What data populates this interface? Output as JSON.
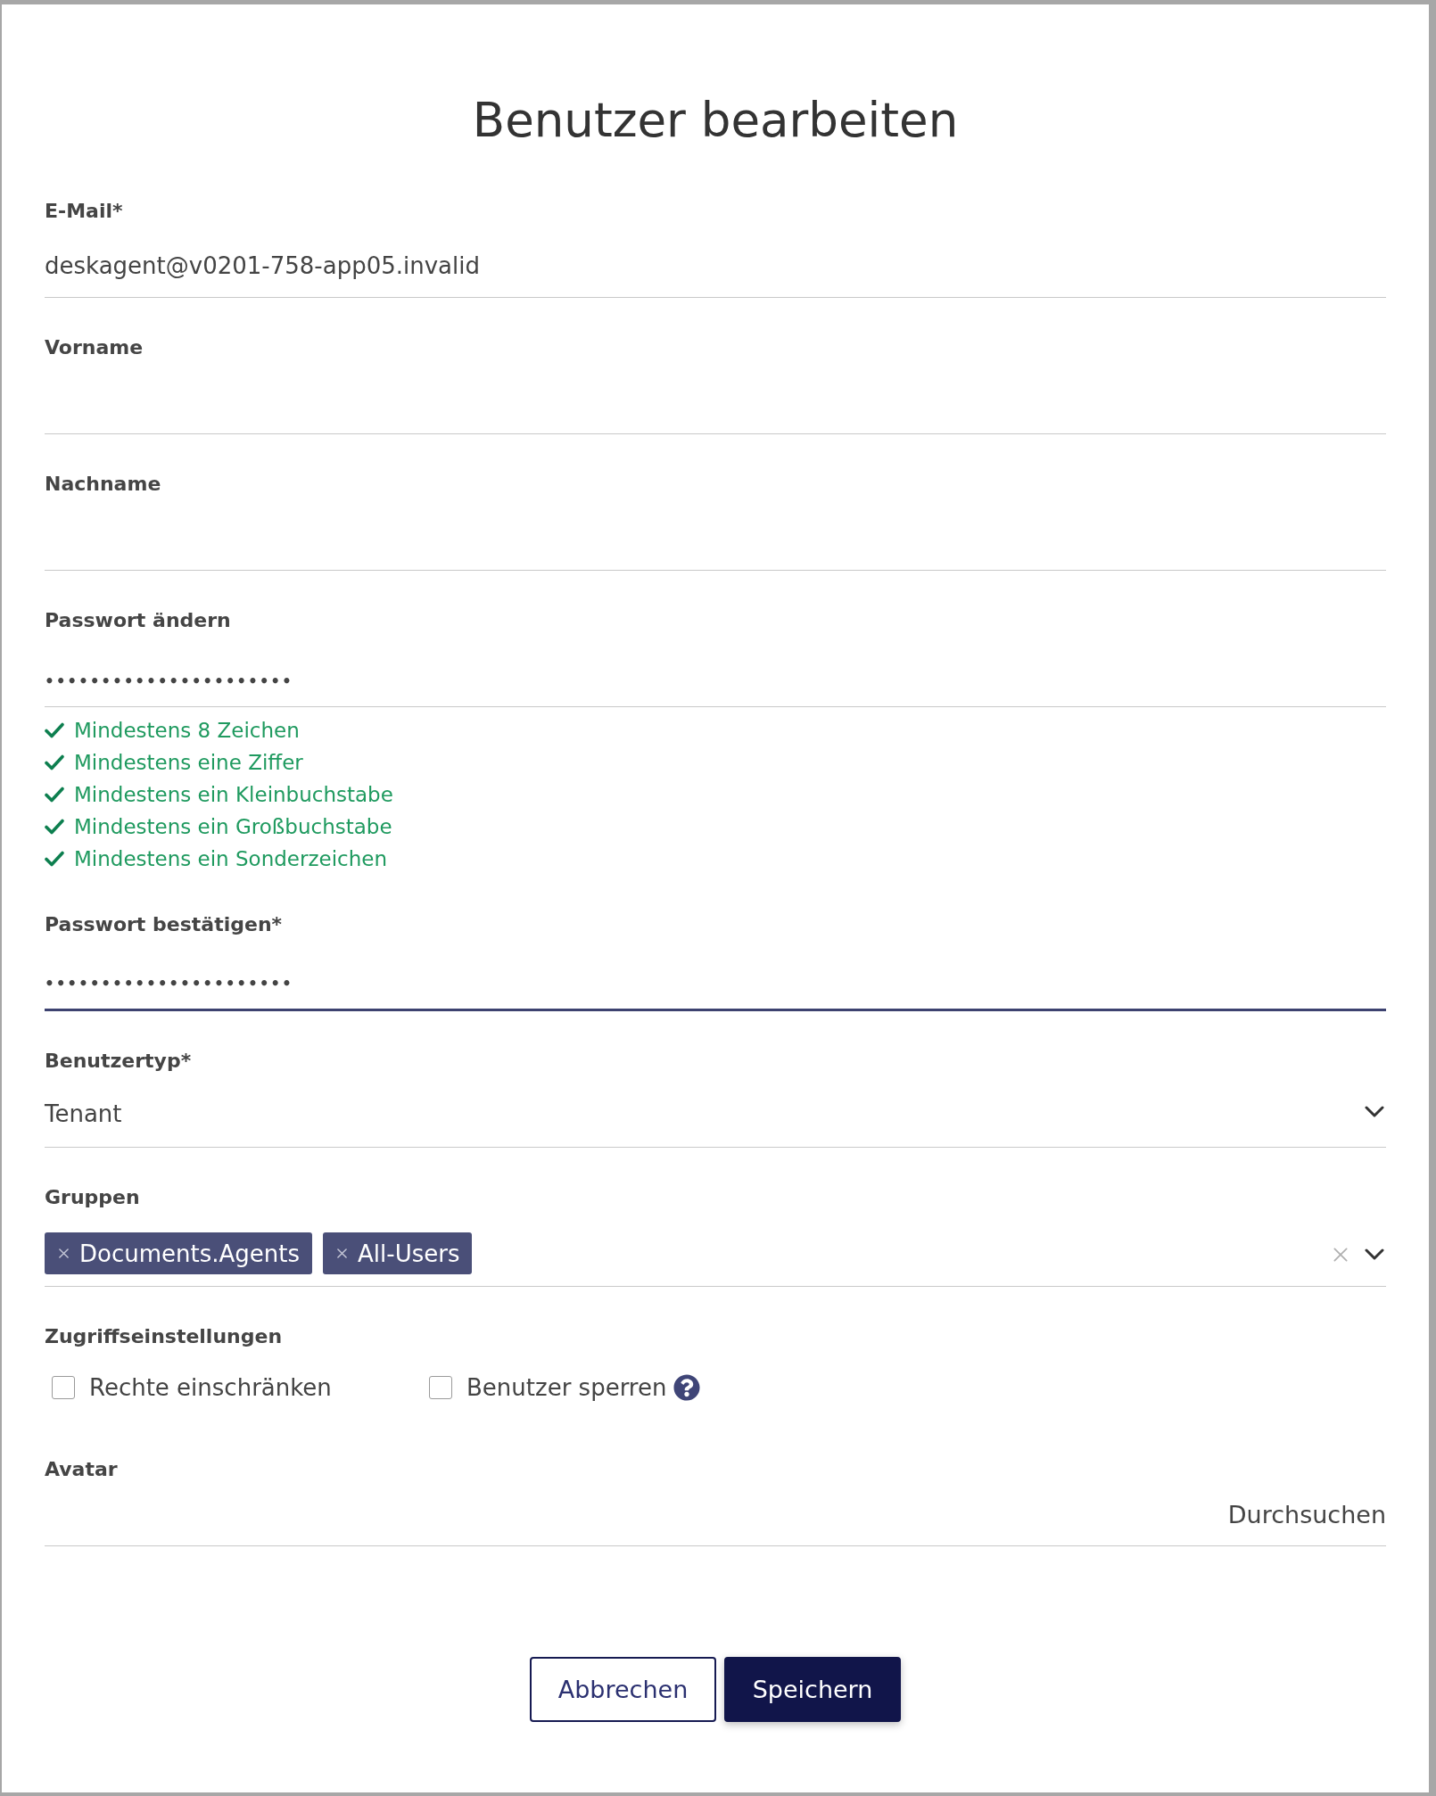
{
  "dialog": {
    "title": "Benutzer bearbeiten"
  },
  "fields": [
    {
      "kind": "text",
      "label": "E-Mail*",
      "value": "deskagent@v0201-758-app05.invalid",
      "focused": false
    },
    {
      "kind": "text",
      "label": "Vorname",
      "focused": false
    },
    {
      "kind": "text",
      "label": "Nachname",
      "focused": false
    },
    {
      "kind": "password",
      "label": "Passwort ändern",
      "value": "••••••••••••••••••••••",
      "focused": false,
      "rules": [
        {
          "text": "Mindestens 8 Zeichen",
          "met": true
        },
        {
          "text": "Mindestens eine Ziffer",
          "met": true
        },
        {
          "text": "Mindestens ein Kleinbuchstabe",
          "met": true
        },
        {
          "text": "Mindestens ein Großbuchstabe",
          "met": true
        },
        {
          "text": "Mindestens ein Sonderzeichen",
          "met": true
        }
      ]
    },
    {
      "kind": "password",
      "label": "Passwort bestätigen*",
      "value": "••••••••••••••••••••••",
      "focused": true
    },
    {
      "kind": "select",
      "label": "Benutzertyp*",
      "value": "Tenant",
      "focused": false
    },
    {
      "kind": "multiselect",
      "label": "Gruppen",
      "chips": [
        "Documents.Agents",
        "All-Users"
      ],
      "focused": false
    },
    {
      "kind": "checkboxes",
      "label": "Zugriffseinstellungen",
      "options": [
        {
          "label": "Rechte einschränken",
          "checked": false,
          "help": false
        },
        {
          "label": "Benutzer sperren",
          "checked": false,
          "help": true
        }
      ]
    },
    {
      "kind": "file",
      "label": "Avatar",
      "button": "Durchsuchen",
      "focused": false
    }
  ],
  "buttons": [
    {
      "label": "Abbrechen",
      "kind": "secondary"
    },
    {
      "label": "Speichern",
      "kind": "primary"
    }
  ]
}
